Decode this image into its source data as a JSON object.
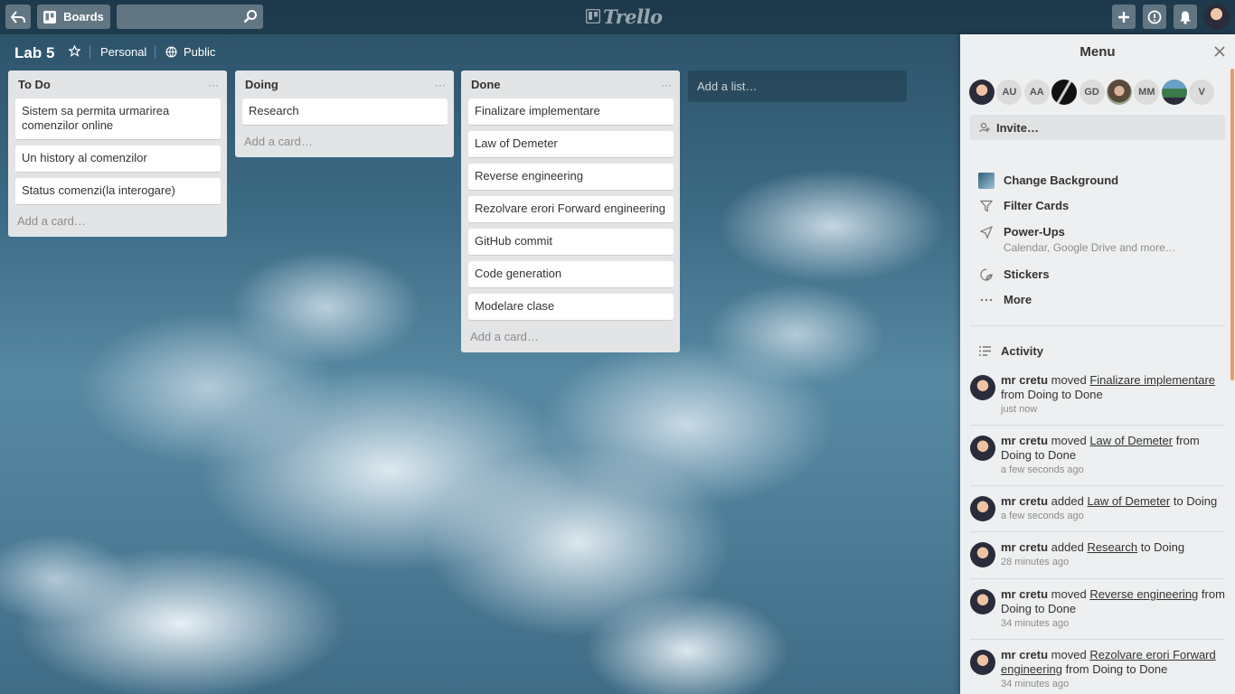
{
  "header": {
    "boards_label": "Boards",
    "search_placeholder": "",
    "logo_text": "Trello"
  },
  "board": {
    "title": "Lab 5",
    "team": "Personal",
    "visibility": "Public"
  },
  "lists": [
    {
      "title": "To Do",
      "menu": "···",
      "cards": [
        "Sistem sa permita urmarirea comenzilor online",
        "Un history al comenzilor",
        "Status comenzi(la interogare)"
      ],
      "add_card": "Add a card…"
    },
    {
      "title": "Doing",
      "menu": "···",
      "cards": [
        "Research"
      ],
      "add_card": "Add a card…"
    },
    {
      "title": "Done",
      "menu": "···",
      "cards": [
        "Finalizare implementare",
        "Law of Demeter",
        "Reverse engineering",
        "Rezolvare erori Forward engineering",
        "GitHub commit",
        "Code generation",
        "Modelare clase"
      ],
      "add_card": "Add a card…"
    }
  ],
  "add_list": "Add a list…",
  "menu": {
    "title": "Menu",
    "members": [
      "AU",
      "AA",
      "GD",
      "MM",
      "V"
    ],
    "invite": "Invite…",
    "items": {
      "change_background": "Change Background",
      "filter_cards": "Filter Cards",
      "power_ups": "Power-Ups",
      "power_ups_sub": "Calendar, Google Drive and more…",
      "stickers": "Stickers",
      "more": "More"
    },
    "activity_title": "Activity",
    "activity": [
      {
        "user": "mr cretu",
        "action": "moved",
        "link": "Finalizare implementare",
        "rest": "from Doing to Done",
        "time": "just now"
      },
      {
        "user": "mr cretu",
        "action": "moved",
        "link": "Law of Demeter",
        "rest": "from Doing to Done",
        "time": "a few seconds ago"
      },
      {
        "user": "mr cretu",
        "action": "added",
        "link": "Law of Demeter",
        "rest": "to Doing",
        "time": "a few seconds ago"
      },
      {
        "user": "mr cretu",
        "action": "added",
        "link": "Research",
        "rest": "to Doing",
        "time": "28 minutes ago"
      },
      {
        "user": "mr cretu",
        "action": "moved",
        "link": "Reverse engineering",
        "rest": "from Doing to Done",
        "time": "34 minutes ago"
      },
      {
        "user": "mr cretu",
        "action": "moved",
        "link": "Rezolvare erori Forward engineering",
        "rest": "from Doing to Done",
        "time": "34 minutes ago"
      }
    ]
  },
  "colors": {
    "header_bg": "#1f3a4c",
    "list_bg": "#e2e4e6",
    "sidebar_bg": "#edeff0",
    "scroll_accent": "#f19a5d"
  }
}
